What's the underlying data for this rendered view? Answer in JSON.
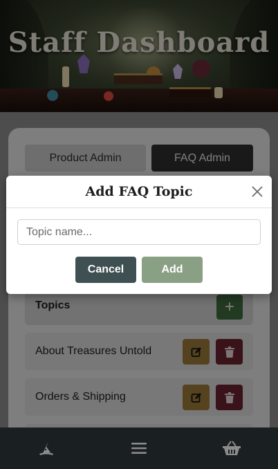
{
  "header": {
    "title": "Staff Dashboard"
  },
  "tabs": [
    {
      "label": "Product Admin",
      "active": false
    },
    {
      "label": "FAQ Admin",
      "active": true
    }
  ],
  "topics_section": {
    "label": "Topics",
    "add_icon": "plus-icon"
  },
  "topics": [
    {
      "name": "About Treasures Untold"
    },
    {
      "name": "Orders & Shipping"
    }
  ],
  "modal": {
    "title": "Add FAQ Topic",
    "input_placeholder": "Topic name...",
    "input_value": "",
    "cancel_label": "Cancel",
    "add_label": "Add"
  },
  "bottom_nav": [
    {
      "icon": "wizard-hat-icon"
    },
    {
      "icon": "menu-icon"
    },
    {
      "icon": "basket-icon"
    }
  ],
  "colors": {
    "cancel": "#3f5052",
    "add": "#8aa085",
    "edit": "#9c7a3a",
    "delete": "#6a2431",
    "add_topic": "#3f6b3e",
    "nav_bg": "#1a1f22"
  }
}
